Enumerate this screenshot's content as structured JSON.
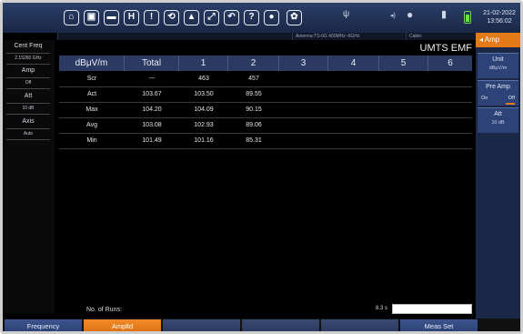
{
  "toolbar": {
    "icons": [
      {
        "name": "home-icon",
        "glyph": "⌂"
      },
      {
        "name": "screenshot-icon",
        "glyph": "▣"
      },
      {
        "name": "folder-icon",
        "glyph": "▬"
      },
      {
        "name": "save-icon",
        "glyph": "H"
      },
      {
        "name": "bulb-icon",
        "glyph": "!"
      },
      {
        "name": "refresh-icon",
        "glyph": "⟲"
      },
      {
        "name": "lock-icon",
        "glyph": "▲"
      },
      {
        "name": "fullscreen-icon",
        "glyph": "⤢"
      },
      {
        "name": "undo-icon",
        "glyph": "↶"
      },
      {
        "name": "help-icon",
        "glyph": "?"
      },
      {
        "name": "record-icon",
        "glyph": "●"
      },
      {
        "name": "settings-icon",
        "glyph": "✿"
      }
    ],
    "usb_glyph": "ψ",
    "volume_glyph": "◂)",
    "date": "21-02-2022",
    "time": "13:56:02"
  },
  "info": {
    "antenna": "Antenna:TS-6G 400MHz~6GHz",
    "cable": "Cable:"
  },
  "left_panel": {
    "cent_freq_label": "Cent Freq",
    "cent_freq_value": "2.15260 GHz",
    "amp_label": "Amp",
    "amp_value": "Off",
    "att_label": "Att",
    "att_value": "10 dB",
    "axis_label": "Axis",
    "axis_value": "Auto"
  },
  "main": {
    "title": "UMTS EMF",
    "headers": [
      "dBμV/m",
      "Total",
      "1",
      "2",
      "3",
      "4",
      "5",
      "6"
    ],
    "rows": [
      {
        "label": "Scr",
        "total": "---",
        "c1": "463",
        "c2": "457"
      },
      {
        "label": "Act",
        "total": "103.67",
        "c1": "103.50",
        "c2": "89.55"
      },
      {
        "label": "Max",
        "total": "104.20",
        "c1": "104.09",
        "c2": "90.15"
      },
      {
        "label": "Avg",
        "total": "103.08",
        "c1": "102.93",
        "c2": "89.06"
      },
      {
        "label": "Min",
        "total": "101.49",
        "c1": "101.16",
        "c2": "85.31"
      }
    ],
    "runs_label": "No. of Runs:",
    "runs_time": "8.3 s"
  },
  "right_panel": {
    "head": "Amp",
    "head_glyph": "◂",
    "unit_title": "Unit",
    "unit_value": "dBμV/m",
    "preamp_title": "Pre Amp",
    "preamp_on": "On",
    "preamp_off": "Off",
    "att_title": "Att",
    "att_value": "10 dB"
  },
  "bottom": {
    "buttons": [
      "Frequency",
      "Ampltd",
      "",
      "",
      "",
      "Meas Set"
    ]
  },
  "colors": {
    "accent": "#e27a18",
    "header_bg": "#2c3a62",
    "toolbar_bg": "#1a2746"
  }
}
